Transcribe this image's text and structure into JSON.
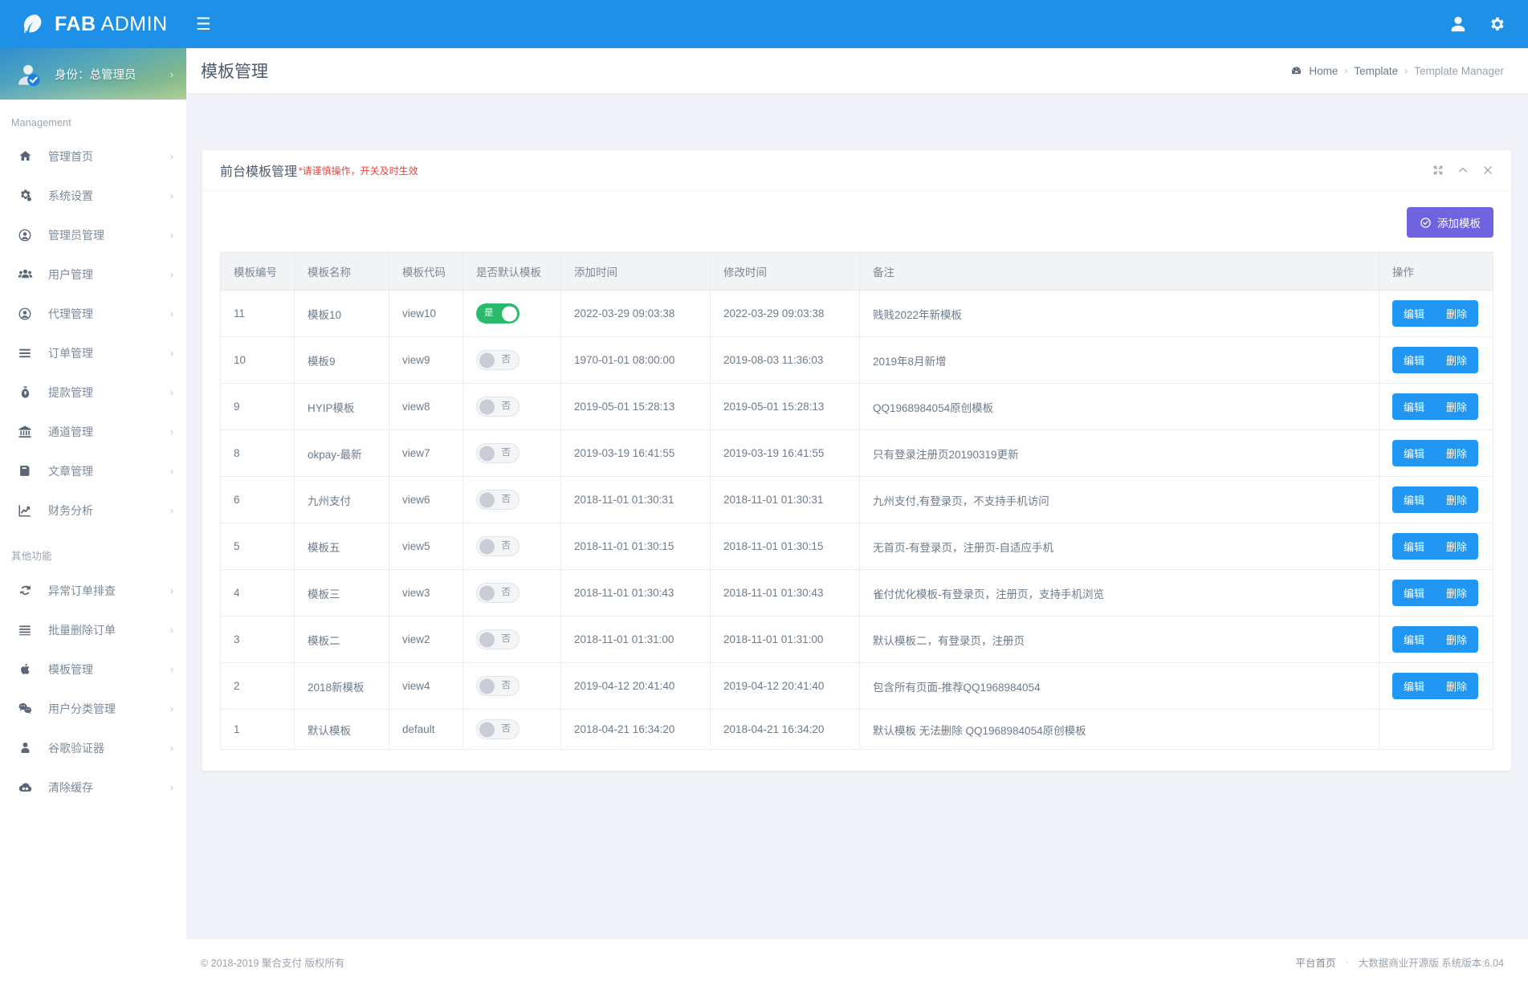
{
  "brand": {
    "bold": "FAB",
    "light": "ADMIN",
    "logo_icon": "fab-logo-icon"
  },
  "topbar": {
    "menu_toggle_icon": "hamburger-icon",
    "user_icon": "user-icon",
    "settings_icon": "gear-icon"
  },
  "sidebar": {
    "profile": {
      "label": "身份：总管理员",
      "avatar_icon": "avatar-verified-icon",
      "arrow": "›"
    },
    "group1_title": "Management",
    "group2_title": "其他功能",
    "group1": [
      {
        "label": "管理首页",
        "icon": "home-icon",
        "arrow": "›"
      },
      {
        "label": "系统设置",
        "icon": "gears-icon",
        "arrow": "›"
      },
      {
        "label": "管理员管理",
        "icon": "user-circle-icon",
        "arrow": "›"
      },
      {
        "label": "用户管理",
        "icon": "users-icon",
        "arrow": "›"
      },
      {
        "label": "代理管理",
        "icon": "user-circle-icon",
        "arrow": "›"
      },
      {
        "label": "订单管理",
        "icon": "list-icon",
        "arrow": "›"
      },
      {
        "label": "提款管理",
        "icon": "money-bag-icon",
        "arrow": "›"
      },
      {
        "label": "通道管理",
        "icon": "bank-icon",
        "arrow": "›"
      },
      {
        "label": "文章管理",
        "icon": "book-icon",
        "arrow": "›"
      },
      {
        "label": "财务分析",
        "icon": "chart-line-icon",
        "arrow": "›"
      }
    ],
    "group2": [
      {
        "label": "异常订单排查",
        "icon": "refresh-icon",
        "arrow": "›"
      },
      {
        "label": "批量删除订单",
        "icon": "list-icon",
        "arrow": "›"
      },
      {
        "label": "模板管理",
        "icon": "apple-icon",
        "arrow": "›"
      },
      {
        "label": "用户分类管理",
        "icon": "wechat-icon",
        "arrow": "›"
      },
      {
        "label": "谷歌验证器",
        "icon": "user-solid-icon",
        "arrow": "›"
      },
      {
        "label": "清除缓存",
        "icon": "cloud-icon",
        "arrow": "›"
      }
    ]
  },
  "page": {
    "title": "模板管理",
    "breadcrumb": {
      "icon": "dashboard-icon",
      "items": [
        "Home",
        "Template",
        "Template Manager"
      ],
      "separator": "›"
    }
  },
  "card": {
    "title": "前台模板管理",
    "warning": "*请谨慎操作，开关及时生效",
    "tools": {
      "expand_icon": "expand-icon",
      "collapse_icon": "chevron-up-icon",
      "close_icon": "close-icon"
    },
    "add_button": {
      "label": "添加模板",
      "icon": "check-circle-icon"
    }
  },
  "table": {
    "columns": [
      "模板编号",
      "模板名称",
      "模板代码",
      "是否默认模板",
      "添加时间",
      "修改时间",
      "备注",
      "操作"
    ],
    "actions": {
      "edit": "编辑",
      "delete": "删除"
    },
    "switch_labels": {
      "on": "是",
      "off": "否"
    },
    "rows": [
      {
        "id": "11",
        "name": "模板10",
        "code": "view10",
        "is_default": true,
        "added": "2022-03-29 09:03:38",
        "modified": "2022-03-29 09:03:38",
        "remark": "贱贱2022年新模板",
        "has_actions": true
      },
      {
        "id": "10",
        "name": "模板9",
        "code": "view9",
        "is_default": false,
        "added": "1970-01-01 08:00:00",
        "modified": "2019-08-03 11:36:03",
        "remark": "2019年8月新增",
        "has_actions": true
      },
      {
        "id": "9",
        "name": "HYIP模板",
        "code": "view8",
        "is_default": false,
        "added": "2019-05-01 15:28:13",
        "modified": "2019-05-01 15:28:13",
        "remark": "QQ1968984054原创模板",
        "has_actions": true
      },
      {
        "id": "8",
        "name": "okpay-最新",
        "code": "view7",
        "is_default": false,
        "added": "2019-03-19 16:41:55",
        "modified": "2019-03-19 16:41:55",
        "remark": "只有登录注册页20190319更新",
        "has_actions": true
      },
      {
        "id": "6",
        "name": "九州支付",
        "code": "view6",
        "is_default": false,
        "added": "2018-11-01 01:30:31",
        "modified": "2018-11-01 01:30:31",
        "remark": "九州支付,有登录页，不支持手机访问",
        "has_actions": true
      },
      {
        "id": "5",
        "name": "模板五",
        "code": "view5",
        "is_default": false,
        "added": "2018-11-01 01:30:15",
        "modified": "2018-11-01 01:30:15",
        "remark": "无首页-有登录页，注册页-自适应手机",
        "has_actions": true
      },
      {
        "id": "4",
        "name": "模板三",
        "code": "view3",
        "is_default": false,
        "added": "2018-11-01 01:30:43",
        "modified": "2018-11-01 01:30:43",
        "remark": "雀付优化模板-有登录页，注册页，支持手机浏览",
        "has_actions": true
      },
      {
        "id": "3",
        "name": "模板二",
        "code": "view2",
        "is_default": false,
        "added": "2018-11-01 01:31:00",
        "modified": "2018-11-01 01:31:00",
        "remark": "默认模板二，有登录页，注册页",
        "has_actions": true
      },
      {
        "id": "2",
        "name": "2018新模板",
        "code": "view4",
        "is_default": false,
        "added": "2019-04-12 20:41:40",
        "modified": "2019-04-12 20:41:40",
        "remark": "包含所有页面-推荐QQ1968984054",
        "has_actions": true
      },
      {
        "id": "1",
        "name": "默认模板",
        "code": "default",
        "is_default": false,
        "added": "2018-04-21 16:34:20",
        "modified": "2018-04-21 16:34:20",
        "remark": "默认模板 无法删除 QQ1968984054原创模板",
        "has_actions": false
      }
    ]
  },
  "footer": {
    "copyright": "© 2018-2019 聚合支付 版权所有",
    "link": "平台首页",
    "dot": "·",
    "version": "大数据商业开源版 系统版本:6.04"
  },
  "colors": {
    "brand_blue": "#1e90e8",
    "accent_purple": "#6f63e0",
    "action_blue": "#2196f3",
    "switch_on_green": "#29bb69",
    "warning_red": "#e8453c"
  }
}
